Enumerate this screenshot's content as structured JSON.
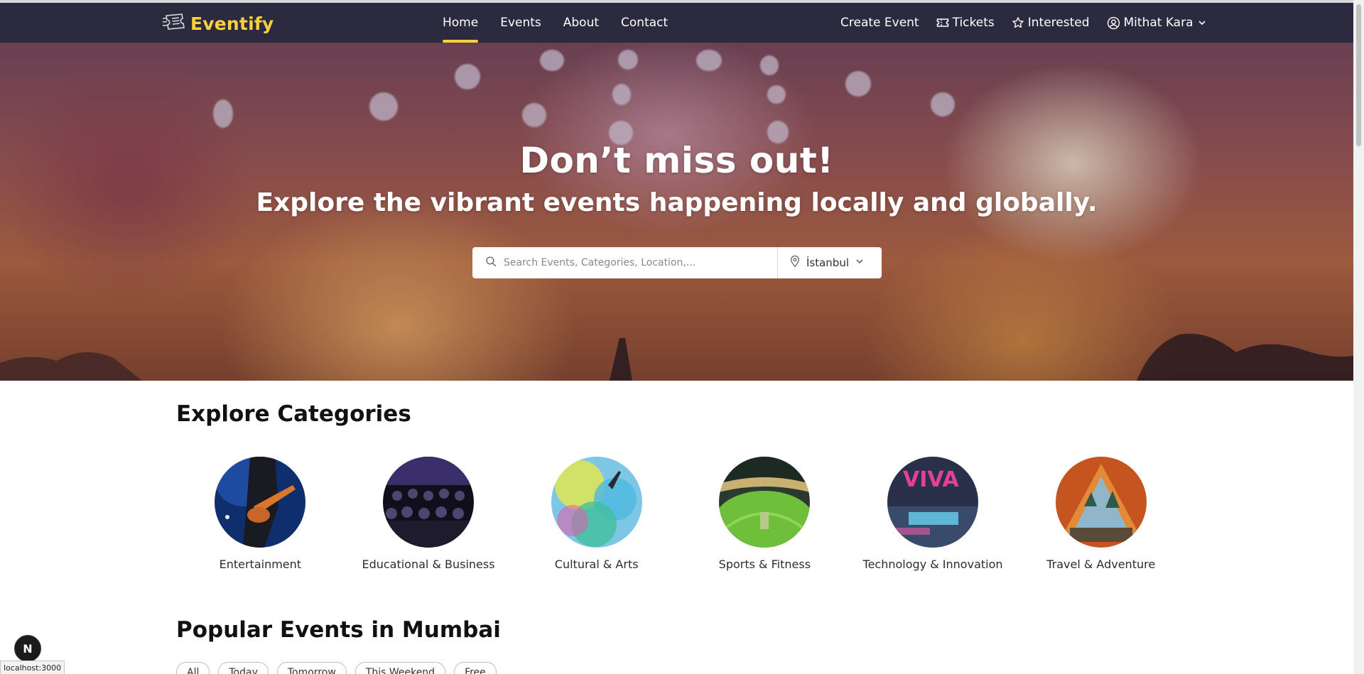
{
  "brand": {
    "name": "Eventify",
    "logo_icon": "ticket-icon",
    "accent": "#f7d13a",
    "nav_bg": "#2b2a3f"
  },
  "nav": {
    "links": [
      {
        "label": "Home",
        "active": true
      },
      {
        "label": "Events",
        "active": false
      },
      {
        "label": "About",
        "active": false
      },
      {
        "label": "Contact",
        "active": false
      }
    ],
    "create_event": "Create Event",
    "tickets": "Tickets",
    "interested": "Interested",
    "user_name": "Mithat Kara"
  },
  "hero": {
    "title": "Don’t miss out!",
    "subtitle": "Explore the vibrant events happening locally and globally.",
    "search_placeholder": "Search Events, Categories, Location,...",
    "location": "İstanbul"
  },
  "categories": {
    "title": "Explore Categories",
    "items": [
      {
        "label": "Entertainment",
        "icon": "guitarist-photo"
      },
      {
        "label": "Educational & Business",
        "icon": "audience-photo"
      },
      {
        "label": "Cultural & Arts",
        "icon": "color-festival-photo"
      },
      {
        "label": "Sports & Fitness",
        "icon": "stadium-photo"
      },
      {
        "label": "Technology & Innovation",
        "icon": "tech-expo-photo"
      },
      {
        "label": "Travel & Adventure",
        "icon": "tent-photo"
      }
    ]
  },
  "popular": {
    "title": "Popular Events in Mumbai",
    "filters": [
      "All",
      "Today",
      "Tomorrow",
      "This Weekend",
      "Free"
    ]
  },
  "dev_badge": "N",
  "status_url": "localhost:3000"
}
